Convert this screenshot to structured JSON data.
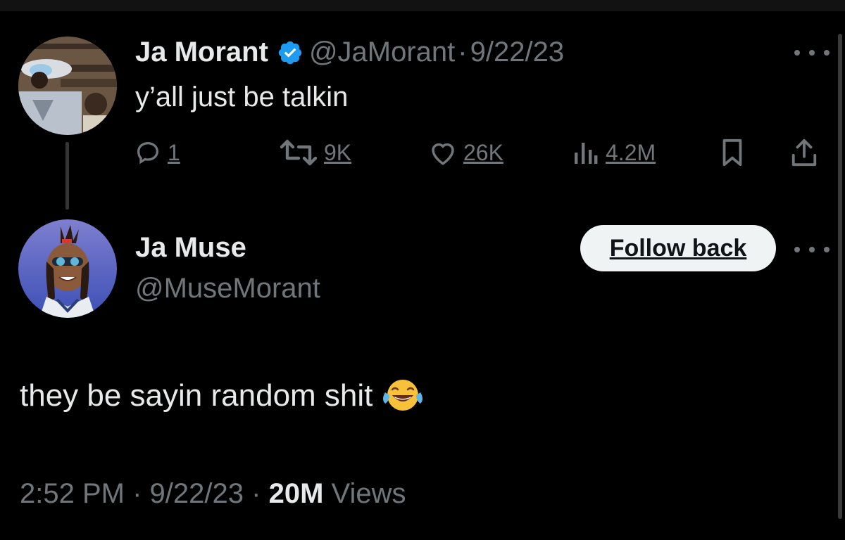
{
  "parent_tweet": {
    "author_name": "Ja Morant",
    "handle": "@JaMorant",
    "separator": "·",
    "date": "9/22/23",
    "text": "y’all just be talkin",
    "stats": {
      "replies": "1",
      "retweets": "9K",
      "likes": "26K",
      "views": "4.2M"
    },
    "verified_badge_color": "#1d9bf0",
    "avatar_icon": "profile-photo"
  },
  "reply_tweet": {
    "author_name": "Ja Muse",
    "handle": "@MuseMorant",
    "follow_button_label": "Follow back",
    "text": "they be sayin random shit",
    "emoji": "face-with-tears-of-joy",
    "avatar_icon": "cartoon-avatar",
    "time": "2:52 PM",
    "separator_1": "·",
    "date": "9/22/23",
    "separator_2": "·",
    "views_count": "20M",
    "views_label": "Views"
  },
  "colors": {
    "background": "#000000",
    "text_primary": "#e7e9ea",
    "text_secondary": "#71767b",
    "button_bg": "#eff3f4"
  }
}
